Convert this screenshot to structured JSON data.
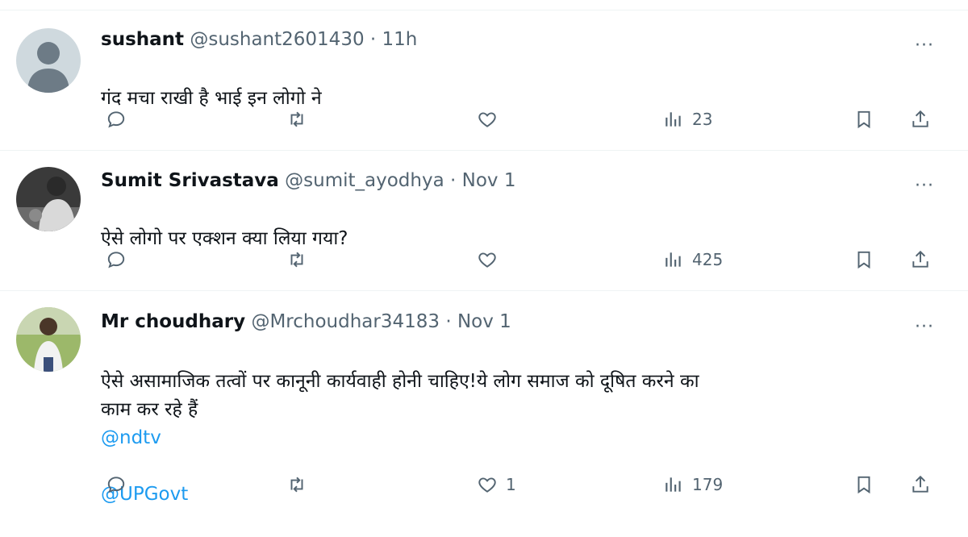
{
  "colors": {
    "text": "#0f1419",
    "secondary": "#536471",
    "link": "#1d9bf0",
    "divider": "#eff3f4"
  },
  "tweets": [
    {
      "name": "sushant",
      "handle": "@sushant2601430",
      "separator": "·",
      "time": "11h",
      "more": "···",
      "text": "गंद मचा राखी है भाई इन लोगो ने",
      "mentions": [],
      "avatar": "default-avatar",
      "stats": {
        "replies": "",
        "reposts": "",
        "likes": "",
        "views": "23"
      }
    },
    {
      "name": "Sumit Srivastava",
      "handle": "@sumit_ayodhya",
      "separator": "·",
      "time": "Nov 1",
      "more": "···",
      "text": "ऐसे लोगो पर एक्शन क्या लिया गया?",
      "mentions": [],
      "avatar": "photo-avatar",
      "stats": {
        "replies": "",
        "reposts": "",
        "likes": "",
        "views": "425"
      }
    },
    {
      "name": "Mr choudhary",
      "handle": "@Mrchoudhar34183",
      "separator": "·",
      "time": "Nov 1",
      "more": "···",
      "text": "ऐसे असामाजिक तत्वों पर कानूनी कार्यवाही होनी चाहिए!ये लोग समाज को दूषित करने का\nकाम कर रहे हैं",
      "mentions": [
        "@ndtv",
        "@UPGovt"
      ],
      "avatar": "photo-avatar",
      "stats": {
        "replies": "",
        "reposts": "",
        "likes": "1",
        "views": "179"
      }
    }
  ],
  "icons": [
    "reply-icon",
    "repost-icon",
    "like-icon",
    "views-icon",
    "bookmark-icon",
    "share-icon"
  ]
}
